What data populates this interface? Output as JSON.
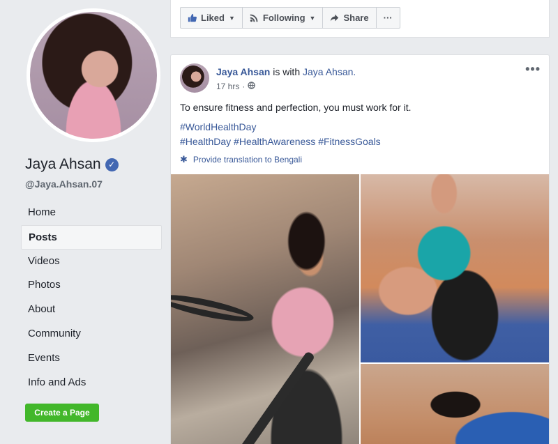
{
  "profile": {
    "name": "Jaya Ahsan",
    "handle": "@Jaya.Ahsan.07",
    "verified_glyph": "✓"
  },
  "nav": {
    "items": [
      {
        "label": "Home",
        "active": false
      },
      {
        "label": "Posts",
        "active": true
      },
      {
        "label": "Videos",
        "active": false
      },
      {
        "label": "Photos",
        "active": false
      },
      {
        "label": "About",
        "active": false
      },
      {
        "label": "Community",
        "active": false
      },
      {
        "label": "Events",
        "active": false
      },
      {
        "label": "Info and Ads",
        "active": false
      }
    ],
    "create_page_label": "Create a Page"
  },
  "actionbar": {
    "liked_label": "Liked",
    "following_label": "Following",
    "share_label": "Share",
    "more_label": "···"
  },
  "post": {
    "author": "Jaya Ahsan",
    "with_text": "is with",
    "tagged": "Jaya Ahsan.",
    "time": "17 hrs",
    "separator": "·",
    "text": "To ensure fitness and perfection, you must work for it.",
    "hashtags_line1": [
      "#WorldHealthDay"
    ],
    "hashtags_line2": [
      "#HealthDay",
      "#HealthAwareness",
      "#FitnessGoals"
    ],
    "translate_label": "Provide translation to Bengali",
    "more_label": "•••"
  },
  "colors": {
    "link": "#385898",
    "brand_blue": "#4267b2",
    "create_green": "#42b72a",
    "page_bg": "#e9ebee"
  },
  "icons": {
    "liked": "thumbs-up-icon",
    "following": "rss-icon",
    "share": "share-arrow-icon",
    "privacy": "globe-icon",
    "translate": "gear-icon",
    "verified": "verified-badge-icon"
  }
}
